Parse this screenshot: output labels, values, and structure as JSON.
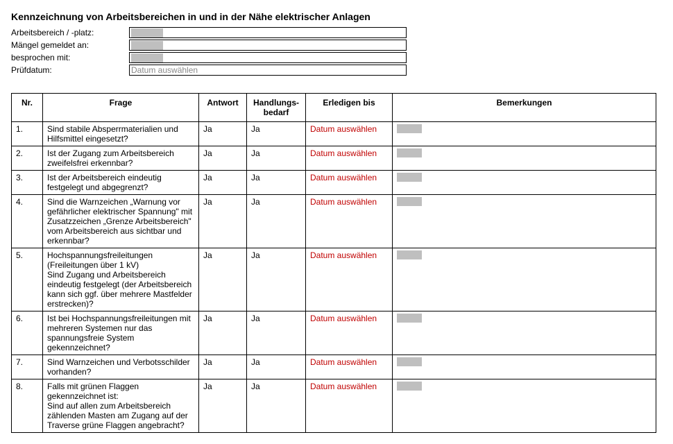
{
  "title": "Kennzeichnung von Arbeitsbereichen in und in der Nähe elektrischer Anlagen",
  "meta": {
    "arbeitsbereich_label": "Arbeitsbereich / -platz:",
    "maengel_label": "Mängel gemeldet an:",
    "besprochen_label": "besprochen mit:",
    "pruefdatum_label": "Prüfdatum:",
    "pruefdatum_placeholder": "Datum auswählen"
  },
  "table": {
    "headers": {
      "nr": "Nr.",
      "frage": "Frage",
      "antwort": "Antwort",
      "bedarf": "Handlungs-bedarf",
      "erledigen": "Erledigen bis",
      "bemerkungen": "Bemerkungen"
    },
    "rows": [
      {
        "nr": "1.",
        "frage": "Sind stabile Absperrmaterialien und Hilfsmittel eingesetzt?",
        "antwort": "Ja",
        "bedarf": "Ja",
        "erledigen": "Datum auswählen"
      },
      {
        "nr": "2.",
        "frage": "Ist der Zugang zum Arbeitsbereich zweifelsfrei erkennbar?",
        "antwort": "Ja",
        "bedarf": "Ja",
        "erledigen": "Datum auswählen"
      },
      {
        "nr": "3.",
        "frage": "Ist der Arbeitsbereich eindeutig festgelegt und abgegrenzt?",
        "antwort": "Ja",
        "bedarf": "Ja",
        "erledigen": "Datum auswählen"
      },
      {
        "nr": "4.",
        "frage": "Sind die Warnzeichen „Warnung vor gefährlicher elektrischer Spannung\" mit Zusatzzeichen „Grenze Arbeitsbereich\" vom Arbeitsbereich aus sichtbar und erkennbar?",
        "antwort": "Ja",
        "bedarf": "Ja",
        "erledigen": "Datum auswählen"
      },
      {
        "nr": "5.",
        "frage": "Hochspannungsfreileitungen (Freileitungen über 1 kV)\nSind Zugang und Arbeitsbereich eindeutig festgelegt (der Arbeitsbereich kann sich ggf. über mehrere Mastfelder erstrecken)?",
        "antwort": "Ja",
        "bedarf": "Ja",
        "erledigen": "Datum auswählen"
      },
      {
        "nr": "6.",
        "frage": "Ist bei Hochspannungsfreileitungen mit mehreren Systemen nur das spannungsfreie System gekennzeichnet?",
        "antwort": "Ja",
        "bedarf": "Ja",
        "erledigen": "Datum auswählen"
      },
      {
        "nr": "7.",
        "frage": "Sind Warnzeichen und Verbotsschilder vorhanden?",
        "antwort": "Ja",
        "bedarf": "Ja",
        "erledigen": "Datum auswählen"
      },
      {
        "nr": "8.",
        "frage": "Falls mit grünen Flaggen gekennzeichnet ist:\nSind auf allen zum Arbeitsbereich zählenden Masten am Zugang auf der Traverse grüne Flaggen angebracht?",
        "antwort": "Ja",
        "bedarf": "Ja",
        "erledigen": "Datum auswählen"
      }
    ]
  }
}
